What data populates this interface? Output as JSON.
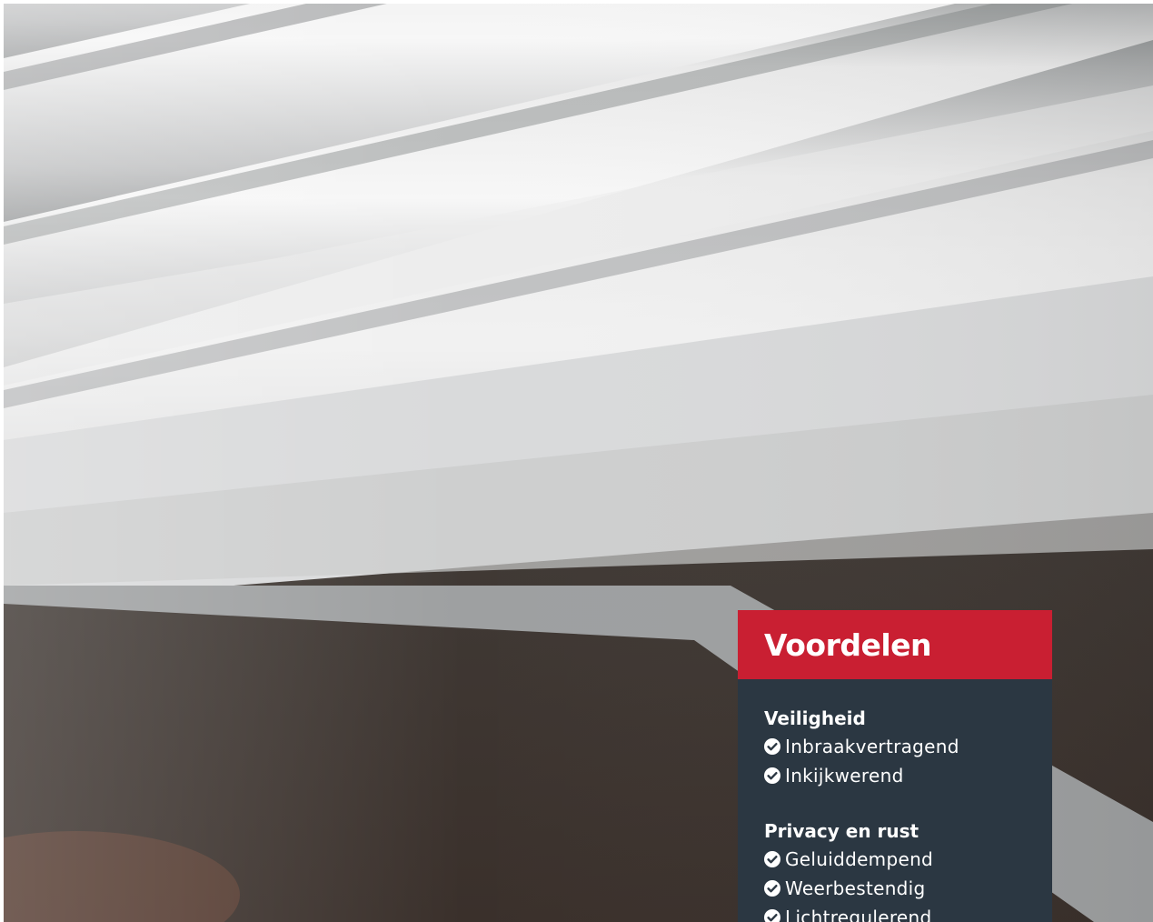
{
  "panel": {
    "title": "Voordelen",
    "groups": [
      {
        "heading": "Veiligheid",
        "items": [
          "Inbraakvertragend",
          "Inkijkwerend"
        ]
      },
      {
        "heading": "Privacy en rust",
        "items": [
          "Geluiddempend",
          "Weerbestendig",
          "Lichtregulerend"
        ]
      }
    ]
  },
  "icons": {
    "bullet": "check-circle-icon"
  },
  "colors": {
    "accent": "#c91f32",
    "panel_background": "#2b3742",
    "text": "#ffffff"
  }
}
